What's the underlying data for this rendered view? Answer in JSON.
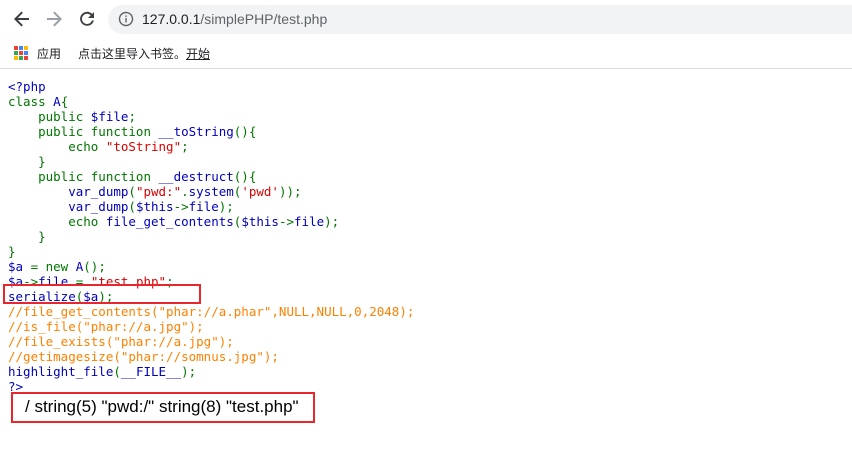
{
  "browser": {
    "url_host": "127.0.0.1",
    "url_path": "/simplePHP/test.php",
    "apps_label": "应用",
    "bookmark_hint": "点击这里导入书签。",
    "bookmark_start": "开始"
  },
  "code": {
    "lines": [
      [
        {
          "t": "<?php",
          "c": "d"
        }
      ],
      [
        {
          "t": "class ",
          "c": "k"
        },
        {
          "t": "A",
          "c": "d"
        },
        {
          "t": "{",
          "c": "k"
        }
      ],
      [
        {
          "t": "    public ",
          "c": "k"
        },
        {
          "t": "$file",
          "c": "d"
        },
        {
          "t": ";",
          "c": "k"
        }
      ],
      [
        {
          "t": "    public function ",
          "c": "k"
        },
        {
          "t": "__toString",
          "c": "d"
        },
        {
          "t": "(){",
          "c": "k"
        }
      ],
      [
        {
          "t": "        echo ",
          "c": "k"
        },
        {
          "t": "\"toString\"",
          "c": "s"
        },
        {
          "t": ";",
          "c": "k"
        }
      ],
      [
        {
          "t": "    }",
          "c": "k"
        }
      ],
      [
        {
          "t": "    public function ",
          "c": "k"
        },
        {
          "t": "__destruct",
          "c": "d"
        },
        {
          "t": "(){",
          "c": "k"
        }
      ],
      [
        {
          "t": "        var_dump",
          "c": "d"
        },
        {
          "t": "(",
          "c": "k"
        },
        {
          "t": "\"pwd:\"",
          "c": "s"
        },
        {
          "t": ".",
          "c": "k"
        },
        {
          "t": "system",
          "c": "d"
        },
        {
          "t": "(",
          "c": "k"
        },
        {
          "t": "'pwd'",
          "c": "s"
        },
        {
          "t": "));",
          "c": "k"
        }
      ],
      [
        {
          "t": "        var_dump",
          "c": "d"
        },
        {
          "t": "(",
          "c": "k"
        },
        {
          "t": "$this",
          "c": "d"
        },
        {
          "t": "->",
          "c": "k"
        },
        {
          "t": "file",
          "c": "d"
        },
        {
          "t": ");",
          "c": "k"
        }
      ],
      [
        {
          "t": "        echo ",
          "c": "k"
        },
        {
          "t": "file_get_contents",
          "c": "d"
        },
        {
          "t": "(",
          "c": "k"
        },
        {
          "t": "$this",
          "c": "d"
        },
        {
          "t": "->",
          "c": "k"
        },
        {
          "t": "file",
          "c": "d"
        },
        {
          "t": ");",
          "c": "k"
        }
      ],
      [
        {
          "t": "    }",
          "c": "k"
        }
      ],
      [
        {
          "t": "}",
          "c": "k"
        }
      ],
      [
        {
          "t": "$a ",
          "c": "d"
        },
        {
          "t": "= new ",
          "c": "k"
        },
        {
          "t": "A",
          "c": "d"
        },
        {
          "t": "();",
          "c": "k"
        }
      ],
      [
        {
          "t": "$a",
          "c": "d"
        },
        {
          "t": "->",
          "c": "k"
        },
        {
          "t": "file ",
          "c": "d"
        },
        {
          "t": "= ",
          "c": "k"
        },
        {
          "t": "\"test.php\"",
          "c": "s"
        },
        {
          "t": ";",
          "c": "k"
        }
      ],
      [
        {
          "t": "serialize",
          "c": "d"
        },
        {
          "t": "(",
          "c": "k"
        },
        {
          "t": "$a",
          "c": "d"
        },
        {
          "t": ");",
          "c": "k"
        }
      ],
      [
        {
          "t": "//file_get_contents(\"phar://a.phar\",NULL,NULL,0,2048);",
          "c": "c"
        }
      ],
      [
        {
          "t": "//is_file(\"phar://a.jpg\");",
          "c": "c"
        }
      ],
      [
        {
          "t": "//file_exists(\"phar://a.jpg\");",
          "c": "c"
        }
      ],
      [
        {
          "t": "//getimagesize(\"phar://somnus.jpg\");",
          "c": "c"
        }
      ],
      [
        {
          "t": "highlight_file",
          "c": "d"
        },
        {
          "t": "(",
          "c": "k"
        },
        {
          "t": "__FILE__",
          "c": "d"
        },
        {
          "t": ");",
          "c": "k"
        }
      ],
      [
        {
          "t": "?>",
          "c": "d"
        }
      ]
    ]
  },
  "output": {
    "text": "/ string(5) \"pwd:/\" string(8) \"test.php\""
  },
  "colors": {
    "keyword": "#007700",
    "default": "#0000bb",
    "string": "#dd0000",
    "comment": "#ff8000",
    "highlight_box": "#e8262b",
    "apps_grid": [
      "#ea4335",
      "#4285f4",
      "#fbbc05",
      "#34a853",
      "#ea4335",
      "#4285f4",
      "#fbbc05",
      "#34a853",
      "#ea4335"
    ]
  }
}
